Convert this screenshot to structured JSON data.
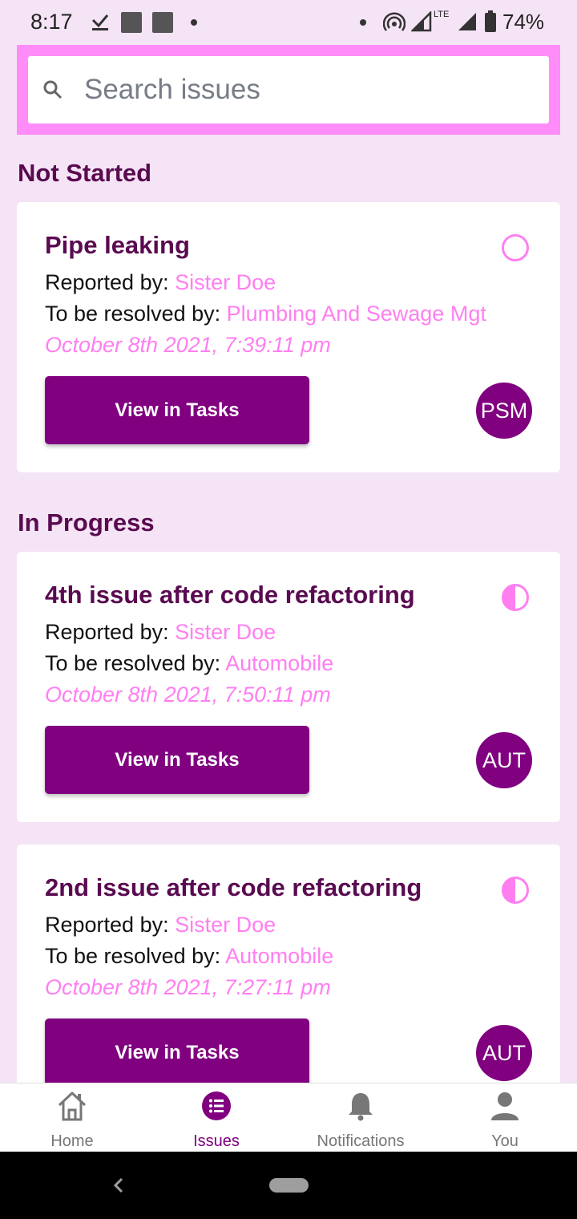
{
  "status_bar": {
    "time": "8:17",
    "battery": "74%",
    "network": "LTE"
  },
  "search": {
    "placeholder": "Search issues",
    "value": ""
  },
  "sections": [
    {
      "heading": "Not Started"
    },
    {
      "heading": "In Progress"
    }
  ],
  "issues": [
    {
      "title": "Pipe leaking",
      "reported_label": "Reported by:",
      "reporter": "Sister Doe",
      "resolver_label": "To be resolved by:",
      "resolver": "Plumbing And Sewage Mgt",
      "date": "October 8th 2021, 7:39:11 pm",
      "button": "View in Tasks",
      "avatar": "PSM",
      "status_icon": "empty-circle-icon"
    },
    {
      "title": "4th issue after code refactoring",
      "reported_label": "Reported by:",
      "reporter": "Sister Doe",
      "resolver_label": "To be resolved by:",
      "resolver": "Automobile",
      "date": "October 8th 2021, 7:50:11 pm",
      "button": "View in Tasks",
      "avatar": "AUT",
      "status_icon": "half-circle-icon"
    },
    {
      "title": "2nd issue after code refactoring",
      "reported_label": "Reported by:",
      "reporter": "Sister Doe",
      "resolver_label": "To be resolved by:",
      "resolver": "Automobile",
      "date": "October 8th 2021, 7:27:11 pm",
      "button": "View in Tasks",
      "avatar": "AUT",
      "status_icon": "half-circle-icon"
    }
  ],
  "nav": [
    {
      "label": "Home",
      "icon": "home-icon"
    },
    {
      "label": "Issues",
      "icon": "list-icon",
      "active": true
    },
    {
      "label": "Notifications",
      "icon": "bell-icon"
    },
    {
      "label": "You",
      "icon": "person-icon"
    }
  ],
  "colors": {
    "accent": "#800080",
    "highlight": "#ff7ff1",
    "search_bar": "#ff8cf8",
    "background": "#f5e4f5"
  }
}
